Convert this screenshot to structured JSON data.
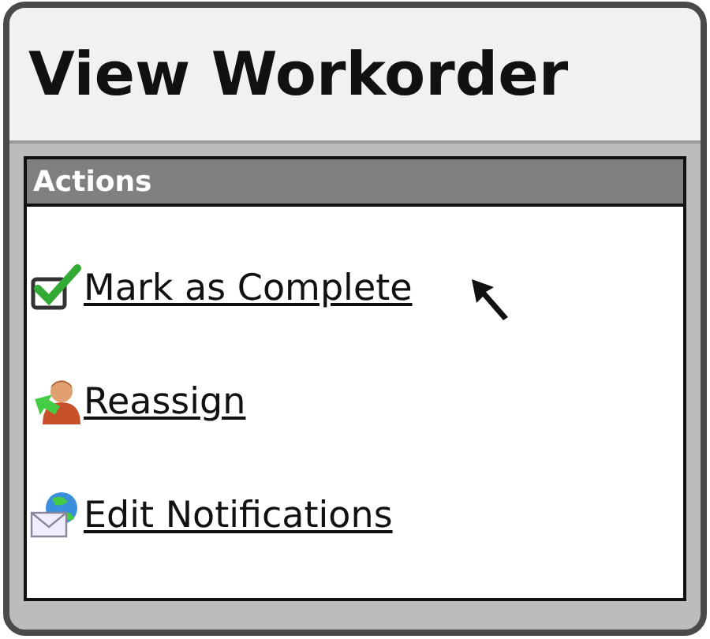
{
  "window": {
    "title": "View Workorder"
  },
  "panel": {
    "title": "Actions"
  },
  "actions": [
    {
      "label": "Mark as Complete",
      "kind": "complete"
    },
    {
      "label": "Reassign",
      "kind": "reassign"
    },
    {
      "label": "Edit Notifications",
      "kind": "notify"
    }
  ]
}
